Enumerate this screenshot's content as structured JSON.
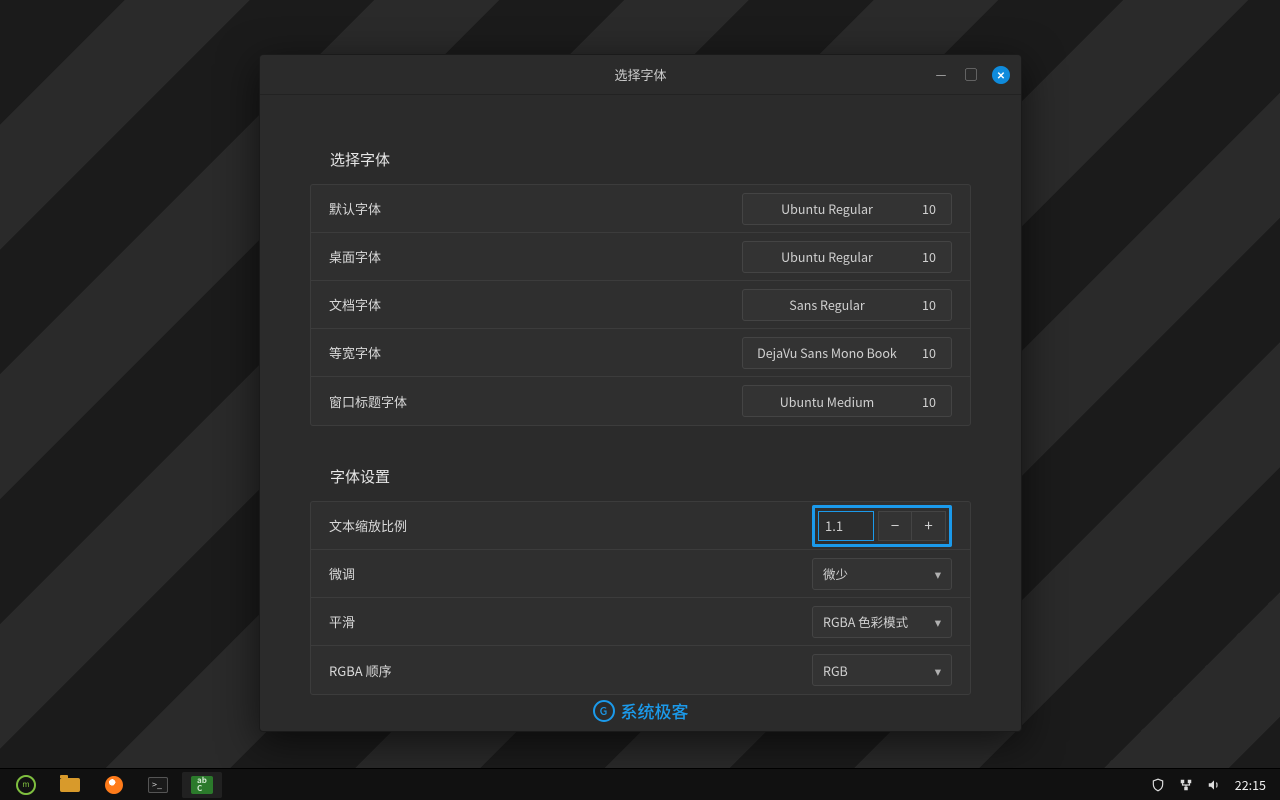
{
  "window": {
    "title": "选择字体",
    "sections": {
      "fonts": {
        "heading": "选择字体",
        "rows": [
          {
            "label": "默认字体",
            "font": "Ubuntu Regular",
            "size": "10"
          },
          {
            "label": "桌面字体",
            "font": "Ubuntu Regular",
            "size": "10"
          },
          {
            "label": "文档字体",
            "font": "Sans Regular",
            "size": "10"
          },
          {
            "label": "等宽字体",
            "font": "DejaVu Sans Mono Book",
            "size": "10"
          },
          {
            "label": "窗口标题字体",
            "font": "Ubuntu Medium",
            "size": "10"
          }
        ]
      },
      "settings": {
        "heading": "字体设置",
        "scale": {
          "label": "文本缩放比例",
          "value": "1.1"
        },
        "hinting": {
          "label": "微调",
          "value": "微少"
        },
        "antialias": {
          "label": "平滑",
          "value": "RGBA 色彩模式"
        },
        "rgba": {
          "label": "RGBA 顺序",
          "value": "RGB"
        }
      }
    },
    "watermark": "系统极客"
  },
  "taskbar": {
    "clock": "22:15"
  },
  "colors": {
    "highlight": "#1b9aeb"
  }
}
